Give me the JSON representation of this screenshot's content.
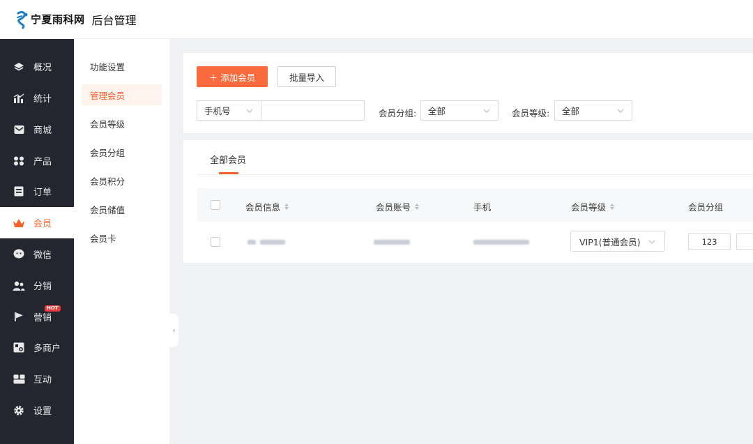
{
  "header": {
    "logo_text": "宁夏雨科网",
    "title": "后台管理"
  },
  "sidebar": {
    "items": [
      {
        "label": "概况",
        "icon": "layers-icon"
      },
      {
        "label": "统计",
        "icon": "chart-icon"
      },
      {
        "label": "商城",
        "icon": "mail-icon"
      },
      {
        "label": "产品",
        "icon": "grid-icon"
      },
      {
        "label": "订单",
        "icon": "order-icon"
      },
      {
        "label": "会员",
        "icon": "crown-icon"
      },
      {
        "label": "微信",
        "icon": "wechat-icon"
      },
      {
        "label": "分销",
        "icon": "users-icon"
      },
      {
        "label": "营销",
        "icon": "flag-icon",
        "badge": "HOT"
      },
      {
        "label": "多商户",
        "icon": "store-icon"
      },
      {
        "label": "互动",
        "icon": "interact-icon"
      },
      {
        "label": "设置",
        "icon": "gear-icon"
      }
    ]
  },
  "submenu": {
    "items": [
      "功能设置",
      "管理会员",
      "会员等级",
      "会员分组",
      "会员积分",
      "会员储值",
      "会员卡"
    ]
  },
  "filters": {
    "add_button": "＋ 添加会员",
    "import_button": "批量导入",
    "search_type": "手机号",
    "group_label": "会员分组:",
    "group_value": "全部",
    "level_label": "会员等级:",
    "level_value": "全部"
  },
  "table": {
    "tab": "全部会员",
    "columns": [
      "会员信息",
      "会员账号",
      "手机",
      "会员等级",
      "会员分组"
    ],
    "rows": [
      {
        "level": "VIP1(普通会员)",
        "group": "123"
      }
    ]
  },
  "colors": {
    "accent": "#f5622d",
    "sidebar_bg": "#23262e"
  }
}
